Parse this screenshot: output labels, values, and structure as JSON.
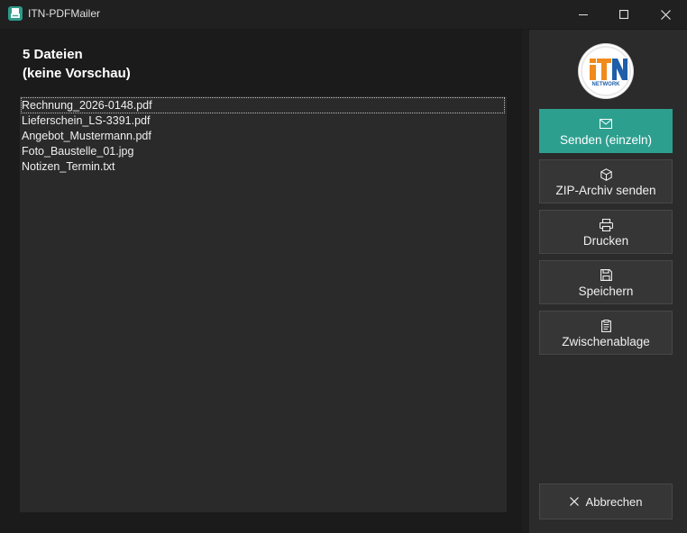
{
  "window": {
    "title": "ITN-PDFMailer"
  },
  "header": {
    "count_line": "5 Dateien",
    "preview_line": "(keine Vorschau)"
  },
  "files": [
    "Rechnung_2026-0148.pdf",
    "Lieferschein_LS-3391.pdf",
    "Angebot_Mustermann.pdf",
    "Foto_Baustelle_01.jpg",
    "Notizen_Termin.txt"
  ],
  "logo": {
    "mark": "iTN",
    "sub": "NETWORK"
  },
  "actions": {
    "send_single": {
      "label": "Senden (einzeln)",
      "icon": "mail-icon"
    },
    "send_zip": {
      "label": "ZIP-Archiv senden",
      "icon": "package-icon"
    },
    "print": {
      "label": "Drucken",
      "icon": "printer-icon"
    },
    "save": {
      "label": "Speichern",
      "icon": "save-icon"
    },
    "clipboard": {
      "label": "Zwischenablage",
      "icon": "clipboard-icon"
    },
    "cancel": {
      "label": "Abbrechen",
      "icon": "close-icon"
    }
  },
  "colors": {
    "accent": "#2d9f8f",
    "logo_orange": "#f08a1c",
    "logo_blue": "#1f5ea8"
  }
}
